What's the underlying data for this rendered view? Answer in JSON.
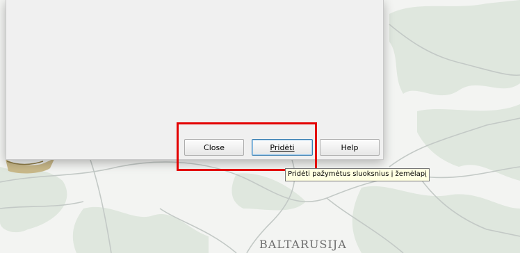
{
  "dialog": {
    "buttons": {
      "close": "Close",
      "add": "Pridėti",
      "help": "Help"
    }
  },
  "tooltip": {
    "text": "Pridėti pažymėtus sluoksnius į žemėlapį"
  },
  "map": {
    "label": "BALTARUSIJA"
  },
  "colors": {
    "highlight": "#e30000",
    "tooltip_bg": "#ffffe1",
    "map_land": "#f3f4f2",
    "map_forest": "#d9e3d8",
    "map_roads": "#bfc5c2"
  }
}
